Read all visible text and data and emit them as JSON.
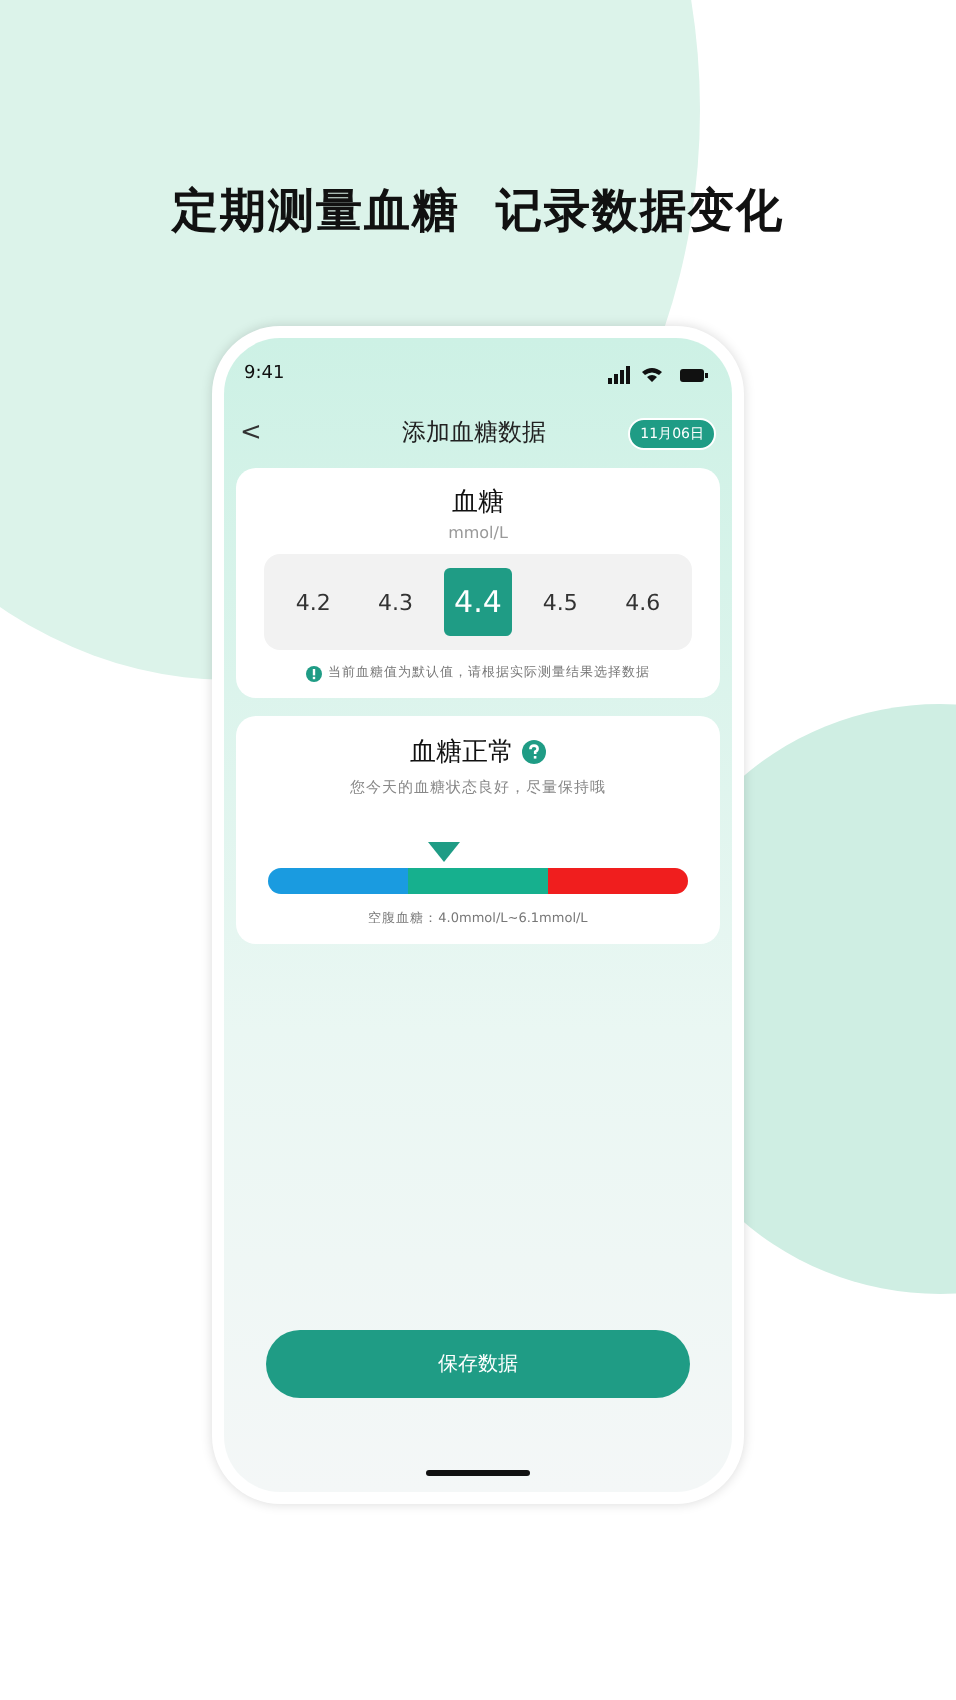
{
  "headline": "定期测量血糖  记录数据变化",
  "status_bar": {
    "time": "9:41"
  },
  "nav": {
    "back": "<",
    "title": "添加血糖数据",
    "date_badge": "11月06日"
  },
  "glucose_card": {
    "title": "血糖",
    "unit": "mmol/L",
    "values": [
      {
        "label": "4.2",
        "selected": false
      },
      {
        "label": "4.3",
        "selected": false
      },
      {
        "label": "4.4",
        "selected": true
      },
      {
        "label": "4.5",
        "selected": false
      },
      {
        "label": "4.6",
        "selected": false
      }
    ],
    "tip": "当前血糖值为默认值，请根据实际测量结果选择数据"
  },
  "status_card": {
    "title": "血糖正常",
    "subtitle": "您今天的血糖状态良好，尽量保持哦",
    "segments": [
      {
        "color": "#1a9be0"
      },
      {
        "color": "#16b08e"
      },
      {
        "color": "#f01e1e"
      }
    ],
    "marker": {
      "level": 0.42
    },
    "range": "空腹血糖：4.0mmol/L~6.1mmol/L"
  },
  "save_button": "保存数据"
}
